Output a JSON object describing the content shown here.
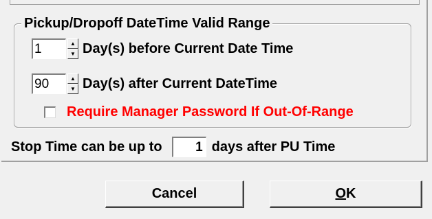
{
  "group": {
    "legend": "Pickup/Dropoff DateTime Valid Range",
    "before": {
      "value": "1",
      "label": "Day(s) before Current Date Time"
    },
    "after": {
      "value": "90",
      "label": "Day(s) after Current DateTime"
    },
    "require_password": {
      "checked": false,
      "label": "Require Manager Password If Out-Of-Range",
      "color": "#ff0000"
    }
  },
  "stop_time": {
    "prefix": "Stop Time can be up to",
    "value": "1",
    "suffix": "days after PU Time"
  },
  "buttons": {
    "cancel": "Cancel",
    "ok_mnemonic": "O",
    "ok_rest": "K"
  }
}
